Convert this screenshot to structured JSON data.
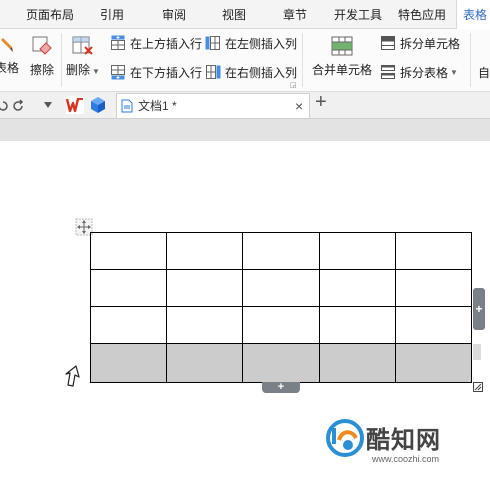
{
  "menu": {
    "tabs": [
      "页面布局",
      "引用",
      "审阅",
      "视图",
      "章节",
      "开发工具",
      "特色应用",
      "表格"
    ]
  },
  "ribbon": {
    "table_label": "表格",
    "erase_label": "擦除",
    "delete_label": "删除",
    "insert_above": "在上方插入行",
    "insert_below": "在下方插入行",
    "insert_left": "在左侧插入列",
    "insert_right": "在右侧插入列",
    "merge_cells": "合并单元格",
    "split_cells": "拆分单元格",
    "split_table": "拆分表格",
    "auto_label": "自"
  },
  "document": {
    "tab_title": "文档1 *",
    "table": {
      "rows": 4,
      "cols": 5,
      "selected_row": 4
    }
  },
  "watermark": {
    "name": "酷知网",
    "url": "www.coozhi.com"
  },
  "colors": {
    "active_tab": "#2f6bd0",
    "selection": "#cccccc",
    "wps_red": "#d9321f",
    "cube_blue": "#2d7be5"
  }
}
